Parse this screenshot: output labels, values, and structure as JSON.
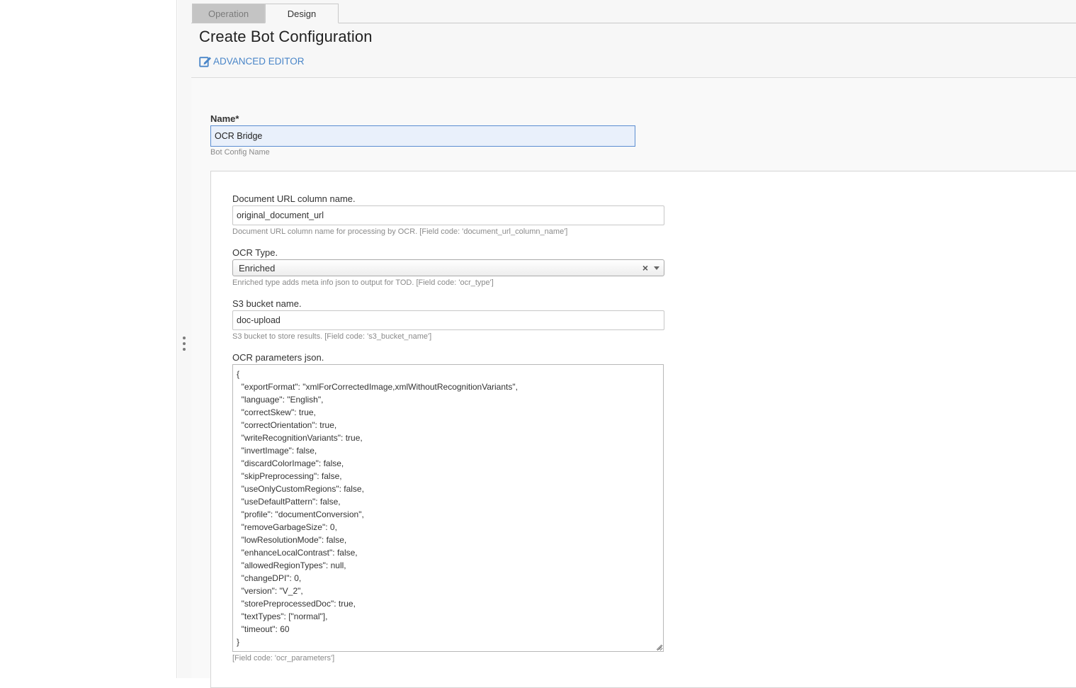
{
  "tabs": [
    {
      "label": "Operation"
    },
    {
      "label": "Design"
    }
  ],
  "page": {
    "title": "Create Bot Configuration",
    "advanced_editor": "ADVANCED EDITOR"
  },
  "name_field": {
    "label": "Name*",
    "value": "OCR Bridge",
    "hint": "Bot Config Name"
  },
  "fields": {
    "document_url": {
      "label": "Document URL column name.",
      "value": "original_document_url",
      "hint": "Document URL column name for processing by OCR. [Field code: 'document_url_column_name']"
    },
    "ocr_type": {
      "label": "OCR Type.",
      "value": "Enriched",
      "clear_glyph": "×",
      "hint": "Enriched type adds meta info json to output for TOD. [Field code: 'ocr_type']"
    },
    "s3_bucket": {
      "label": "S3 bucket name.",
      "value": "doc-upload",
      "hint": "S3 bucket to store results. [Field code: 's3_bucket_name']"
    },
    "ocr_parameters": {
      "label": "OCR parameters json.",
      "value": "{\n  \"exportFormat\": \"xmlForCorrectedImage,xmlWithoutRecognitionVariants\",\n  \"language\": \"English\",\n  \"correctSkew\": true,\n  \"correctOrientation\": true,\n  \"writeRecognitionVariants\": true,\n  \"invertImage\": false,\n  \"discardColorImage\": false,\n  \"skipPreprocessing\": false,\n  \"useOnlyCustomRegions\": false,\n  \"useDefaultPattern\": false,\n  \"profile\": \"documentConversion\",\n  \"removeGarbageSize\": 0,\n  \"lowResolutionMode\": false,\n  \"enhanceLocalContrast\": false,\n  \"allowedRegionTypes\": null,\n  \"changeDPI\": 0,\n  \"version\": \"V_2\",\n  \"storePreprocessedDoc\": true,\n  \"textTypes\": [\"normal\"],\n  \"timeout\": 60\n}",
      "hint": "[Field code: 'ocr_parameters']"
    }
  },
  "icons": {
    "advanced_editor": "edit-icon",
    "splitter": "drag-handle-icon",
    "select_arrow": "chevron-down-icon",
    "resize": "resize-grip-icon"
  },
  "colors": {
    "accent": "#4a86c8",
    "focus_border": "#5b8dd1",
    "focus_bg": "#e9f0fb"
  }
}
